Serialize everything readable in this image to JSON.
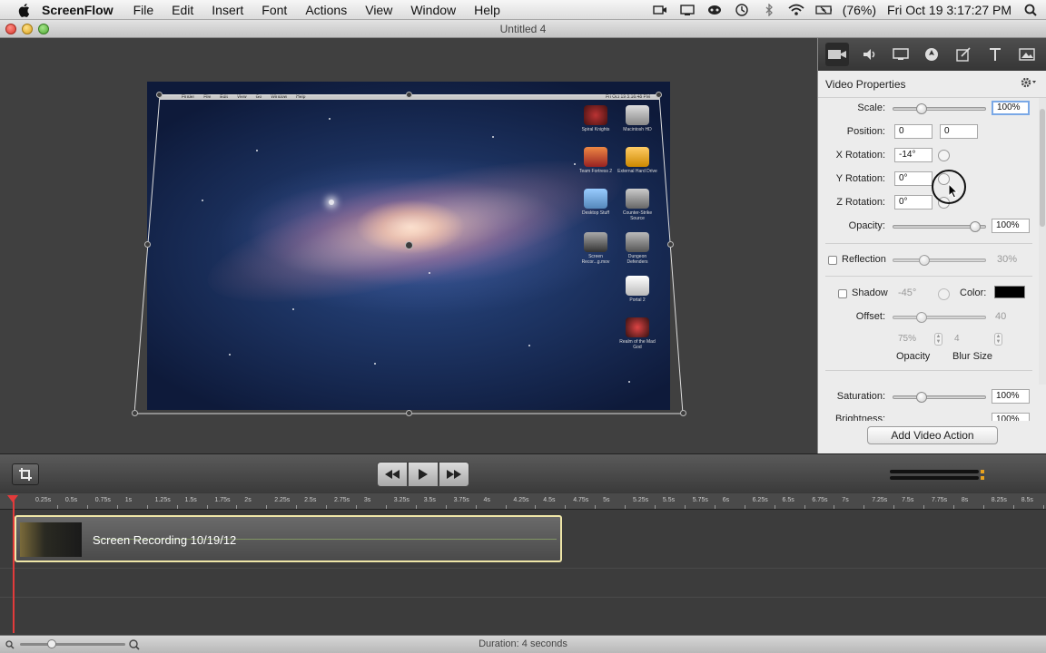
{
  "menubar": {
    "app": "ScreenFlow",
    "items": [
      "File",
      "Edit",
      "Insert",
      "Font",
      "Actions",
      "View",
      "Window",
      "Help"
    ],
    "battery": "(76%)",
    "clock": "Fri Oct 19  3:17:27 PM"
  },
  "window": {
    "title": "Untitled 4"
  },
  "video": {
    "menu_items": [
      "Finder",
      "File",
      "Edit",
      "View",
      "Go",
      "Window",
      "Help"
    ],
    "menu_clock": "Fri Oct 19 3:16:48 PM",
    "desktop_icons": [
      "Spiral Knights",
      "Macintosh HD",
      "Team Fortress 2",
      "External Hard Drive",
      "Desktop Stuff",
      "Counter-Strike Source",
      "Screen Recor...g.mov",
      "Dungeon Defenders",
      "Portal 2",
      "Realm of the Mad God"
    ]
  },
  "inspector": {
    "title": "Video Properties",
    "scale": {
      "label": "Scale:",
      "value": "100%",
      "slider": 0.28
    },
    "position": {
      "label": "Position:",
      "x": "0",
      "y": "0"
    },
    "x_rotation": {
      "label": "X Rotation:",
      "value": "-14°"
    },
    "y_rotation": {
      "label": "Y Rotation:",
      "value": "0°"
    },
    "z_rotation": {
      "label": "Z Rotation:",
      "value": "0°"
    },
    "opacity": {
      "label": "Opacity:",
      "value": "100%",
      "slider": 0.94
    },
    "reflection": {
      "label": "Reflection",
      "value": "30%",
      "slider": 0.32
    },
    "shadow": {
      "label": "Shadow",
      "angle": "-45°",
      "color_label": "Color:",
      "color": "#000000"
    },
    "offset": {
      "label": "Offset:",
      "value": "40",
      "slider": 0.28
    },
    "shadow_opacity": {
      "value": "75%",
      "label": "Opacity"
    },
    "blur": {
      "value": "4",
      "label": "Blur Size"
    },
    "saturation": {
      "label": "Saturation:",
      "value": "100%",
      "slider": 0.28
    },
    "brightness": {
      "label": "Brightness:",
      "value": "100%"
    },
    "add_action": "Add Video Action"
  },
  "timeline": {
    "ticks": [
      "0.25s",
      "0.5s",
      "0.75s",
      "1s",
      "1.25s",
      "1.5s",
      "1.75s",
      "2s",
      "2.25s",
      "2.5s",
      "2.75s",
      "3s",
      "3.25s",
      "3.5s",
      "3.75s",
      "4s",
      "4.25s",
      "4.5s",
      "4.75s",
      "5s",
      "5.25s",
      "5.5s",
      "5.75s",
      "6s",
      "6.25s",
      "6.5s",
      "6.75s",
      "7s",
      "7.25s",
      "7.5s",
      "7.75s",
      "8s",
      "8.25s",
      "8.5s"
    ],
    "clip_label": "Screen Recording 10/19/12"
  },
  "status": {
    "duration": "Duration: 4 seconds"
  },
  "colors": {
    "accent_focus": "#7aa8e6",
    "clip_border": "#efe6a8",
    "playhead": "#e23b3b"
  }
}
